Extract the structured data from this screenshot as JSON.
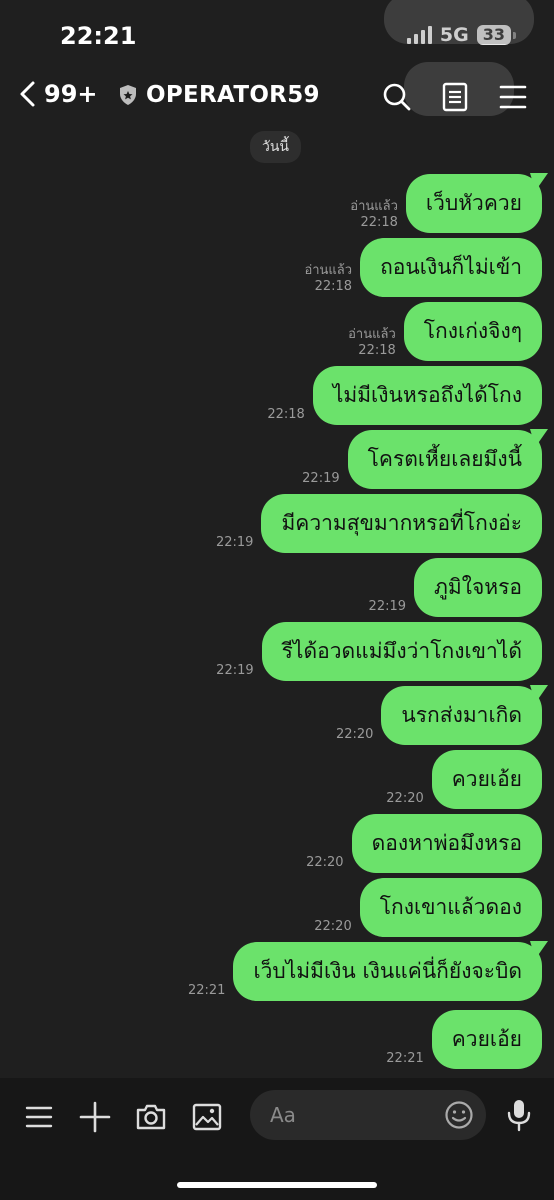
{
  "status_bar": {
    "time": "22:21",
    "network": "5G",
    "battery": "33"
  },
  "header": {
    "back_count": "99+",
    "title": "OPERATOR59"
  },
  "date_chip": "วันนี้",
  "messages": [
    {
      "text": "เว็บหัวควย",
      "read": "อ่านแล้ว",
      "time": "22:18"
    },
    {
      "text": "ถอนเงินก็ไม่เข้า",
      "read": "อ่านแล้ว",
      "time": "22:18"
    },
    {
      "text": "โกงเก่งจิงๆ",
      "read": "อ่านแล้ว",
      "time": "22:18"
    },
    {
      "text": "ไม่มีเงินหรอถึงได้โกง",
      "read": "",
      "time": "22:18"
    },
    {
      "text": "โครตเหี้ยเลยมึงนี้",
      "read": "",
      "time": "22:19"
    },
    {
      "text": "มีความสุขมากหรอที่โกงอ่ะ",
      "read": "",
      "time": "22:19"
    },
    {
      "text": "ภูมิใจหรอ",
      "read": "",
      "time": "22:19"
    },
    {
      "text": "รีได้อวดแม่มึงว่าโกงเขาได้",
      "read": "",
      "time": "22:19"
    },
    {
      "text": "นรกส่งมาเกิด",
      "read": "",
      "time": "22:20"
    },
    {
      "text": "ควยเอ้ย",
      "read": "",
      "time": "22:20"
    },
    {
      "text": "ดองหาพ่อมึงหรอ",
      "read": "",
      "time": "22:20"
    },
    {
      "text": "โกงเขาแล้วดอง",
      "read": "",
      "time": "22:20"
    },
    {
      "text": "เว็บไม่มีเงิน เงินแค่นี่ก็ยังจะบิด",
      "read": "",
      "time": "22:21"
    },
    {
      "text": "ควยเอ้ย",
      "read": "",
      "time": "22:21"
    }
  ],
  "input": {
    "placeholder": "Aa"
  },
  "colors": {
    "bubble": "#6be26b",
    "background": "#1f1f1f",
    "bar": "#171717"
  }
}
